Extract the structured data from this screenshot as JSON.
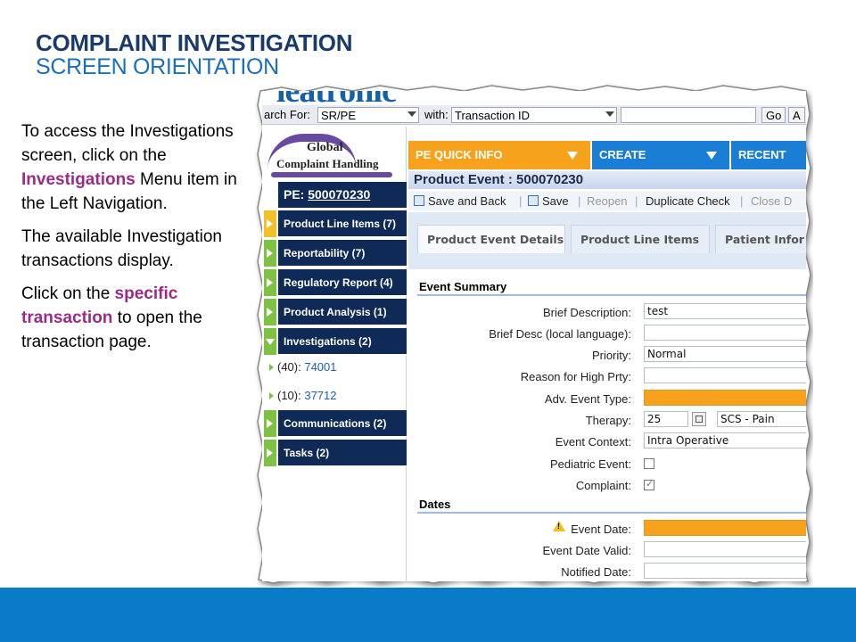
{
  "slide": {
    "title_line1": "COMPLAINT INVESTIGATION",
    "title_line2": "SCREEN ORIENTATION",
    "para1_a": "To access the Investigations screen, click on the ",
    "para1_hl": "Investigations",
    "para1_b": "  Menu item in the Left Navigation.",
    "para2": "The available Investigation transactions display.",
    "para3_a": "Click on the ",
    "para3_hl": "specific transaction",
    "para3_b": " to open the transaction page."
  },
  "app": {
    "logo_text": "leatronic",
    "search": {
      "label_for": "arch For:",
      "for_value": "SR/PE",
      "label_with": "with:",
      "with_value": "Transaction ID",
      "go_label": "Go",
      "a_label": "A"
    },
    "brand": {
      "line1": "Global",
      "line2": "Complaint Handling"
    },
    "leftnav": {
      "pe_label": "PE:",
      "pe_number": "500070230",
      "items": [
        "Product Line Items (7)",
        "Reportability (7)",
        "Regulatory Report (4)",
        "Product Analysis (1)",
        "Investigations (2)",
        "Communications (2)",
        "Tasks (2)"
      ],
      "investigations": [
        {
          "prefix": "(40): ",
          "id": "74001"
        },
        {
          "prefix": "(10): ",
          "id": "37712"
        }
      ]
    },
    "topbar": {
      "quick_info": "PE QUICK INFO",
      "create": "CREATE",
      "recent": "RECENT"
    },
    "header": "Product Event : 500070230",
    "toolbar": {
      "save_back": "Save and Back",
      "save": "Save",
      "reopen": "Reopen",
      "duplicate": "Duplicate Check",
      "close": "Close D"
    },
    "tabs": [
      "Product Event Details",
      "Product Line Items",
      "Patient Infor"
    ],
    "sections": {
      "summary": "Event Summary",
      "dates": "Dates"
    },
    "fields": {
      "brief_desc": {
        "label": "Brief Description:",
        "value": "test"
      },
      "brief_local": {
        "label": "Brief Desc (local language):",
        "value": ""
      },
      "priority": {
        "label": "Priority:",
        "value": "Normal"
      },
      "reason": {
        "label": "Reason for High Prty:",
        "value": ""
      },
      "adv_event": {
        "label": "Adv. Event Type:",
        "value": ""
      },
      "therapy": {
        "label": "Therapy:",
        "code": "25",
        "value": "SCS - Pain"
      },
      "context": {
        "label": "Event Context:",
        "value": "Intra Operative"
      },
      "pediatric": {
        "label": "Pediatric Event:",
        "checked": false
      },
      "complaint": {
        "label": "Complaint:",
        "checked": true
      },
      "event_date": {
        "label": "Event Date:",
        "value": ""
      },
      "event_date_valid": {
        "label": "Event Date Valid:",
        "value": ""
      },
      "notified_date": {
        "label": "Notified Date:",
        "value": ""
      }
    },
    "colors": {
      "nav_dark": "#0f2a56",
      "nav_green": "#7dc242",
      "nav_yellow": "#f2c028",
      "orange": "#f6a21d",
      "blue_tab": "#1a7fd4",
      "band": "#0a7cc7"
    }
  }
}
